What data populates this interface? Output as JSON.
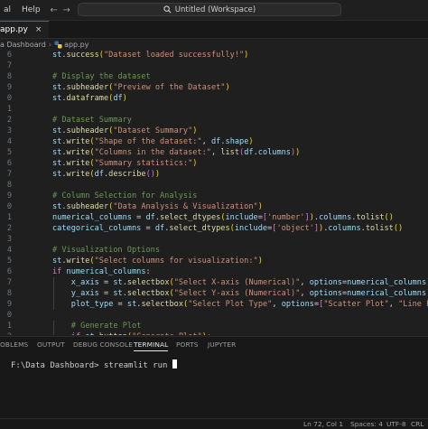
{
  "titlebar": {
    "menu": [
      "al",
      "Help"
    ],
    "back_arrow": "←",
    "forward_arrow": "→",
    "workspace_title": "Untitled (Workspace)"
  },
  "tabs": [
    {
      "label": "app.py",
      "close": "×"
    }
  ],
  "breadcrumb": {
    "folder": "a Dashboard",
    "separator": "›",
    "file": "app.py",
    "file_icon": "python-icon"
  },
  "editor": {
    "lines": [
      {
        "n": "6",
        "indent": 1,
        "tokens": [
          [
            "obj",
            "st"
          ],
          [
            "op",
            "."
          ],
          [
            "fn",
            "success"
          ],
          [
            "br1",
            "("
          ],
          [
            "str",
            "\"Dataset loaded successfully!\""
          ],
          [
            "br1",
            ")"
          ]
        ]
      },
      {
        "n": "7",
        "indent": 0,
        "tokens": []
      },
      {
        "n": "8",
        "indent": 1,
        "tokens": [
          [
            "cm",
            "# Display the dataset"
          ]
        ]
      },
      {
        "n": "9",
        "indent": 1,
        "tokens": [
          [
            "obj",
            "st"
          ],
          [
            "op",
            "."
          ],
          [
            "fn",
            "subheader"
          ],
          [
            "br1",
            "("
          ],
          [
            "str",
            "\"Preview of the Dataset\""
          ],
          [
            "br1",
            ")"
          ]
        ]
      },
      {
        "n": "0",
        "indent": 1,
        "tokens": [
          [
            "obj",
            "st"
          ],
          [
            "op",
            "."
          ],
          [
            "fn",
            "dataframe"
          ],
          [
            "br1",
            "("
          ],
          [
            "obj",
            "df"
          ],
          [
            "br1",
            ")"
          ]
        ]
      },
      {
        "n": "1",
        "indent": 0,
        "tokens": []
      },
      {
        "n": "2",
        "indent": 1,
        "tokens": [
          [
            "cm",
            "# Dataset Summary"
          ]
        ]
      },
      {
        "n": "3",
        "indent": 1,
        "tokens": [
          [
            "obj",
            "st"
          ],
          [
            "op",
            "."
          ],
          [
            "fn",
            "subheader"
          ],
          [
            "br1",
            "("
          ],
          [
            "str",
            "\"Dataset Summary\""
          ],
          [
            "br1",
            ")"
          ]
        ]
      },
      {
        "n": "4",
        "indent": 1,
        "tokens": [
          [
            "obj",
            "st"
          ],
          [
            "op",
            "."
          ],
          [
            "fn",
            "write"
          ],
          [
            "br1",
            "("
          ],
          [
            "str",
            "\"Shape of the dataset:\""
          ],
          [
            "op",
            ", "
          ],
          [
            "obj",
            "df"
          ],
          [
            "op",
            "."
          ],
          [
            "obj",
            "shape"
          ],
          [
            "br1",
            ")"
          ]
        ]
      },
      {
        "n": "5",
        "indent": 1,
        "tokens": [
          [
            "obj",
            "st"
          ],
          [
            "op",
            "."
          ],
          [
            "fn",
            "write"
          ],
          [
            "br1",
            "("
          ],
          [
            "str",
            "\"Columns in the dataset:\""
          ],
          [
            "op",
            ", "
          ],
          [
            "fn",
            "list"
          ],
          [
            "br2",
            "("
          ],
          [
            "obj",
            "df"
          ],
          [
            "op",
            "."
          ],
          [
            "obj",
            "columns"
          ],
          [
            "br2",
            ")"
          ],
          [
            "br1",
            ")"
          ]
        ]
      },
      {
        "n": "6",
        "indent": 1,
        "tokens": [
          [
            "obj",
            "st"
          ],
          [
            "op",
            "."
          ],
          [
            "fn",
            "write"
          ],
          [
            "br1",
            "("
          ],
          [
            "str",
            "\"Summary statistics:\""
          ],
          [
            "br1",
            ")"
          ]
        ]
      },
      {
        "n": "7",
        "indent": 1,
        "tokens": [
          [
            "obj",
            "st"
          ],
          [
            "op",
            "."
          ],
          [
            "fn",
            "write"
          ],
          [
            "br1",
            "("
          ],
          [
            "obj",
            "df"
          ],
          [
            "op",
            "."
          ],
          [
            "fn",
            "describe"
          ],
          [
            "br2",
            "()"
          ],
          [
            "br1",
            ")"
          ]
        ]
      },
      {
        "n": "8",
        "indent": 0,
        "tokens": []
      },
      {
        "n": "9",
        "indent": 1,
        "tokens": [
          [
            "cm",
            "# Column Selection for Analysis"
          ]
        ]
      },
      {
        "n": "0",
        "indent": 1,
        "tokens": [
          [
            "obj",
            "st"
          ],
          [
            "op",
            "."
          ],
          [
            "fn",
            "subheader"
          ],
          [
            "br1",
            "("
          ],
          [
            "str",
            "\"Data Analysis & Visualization\""
          ],
          [
            "br1",
            ")"
          ]
        ]
      },
      {
        "n": "1",
        "indent": 1,
        "tokens": [
          [
            "obj",
            "numerical_columns"
          ],
          [
            "op",
            " = "
          ],
          [
            "obj",
            "df"
          ],
          [
            "op",
            "."
          ],
          [
            "fn",
            "select_dtypes"
          ],
          [
            "br1",
            "("
          ],
          [
            "obj",
            "include"
          ],
          [
            "op",
            "="
          ],
          [
            "br2",
            "["
          ],
          [
            "str",
            "'number'"
          ],
          [
            "br2",
            "]"
          ],
          [
            "br1",
            ")"
          ],
          [
            "op",
            "."
          ],
          [
            "obj",
            "columns"
          ],
          [
            "op",
            "."
          ],
          [
            "fn",
            "tolist"
          ],
          [
            "br1",
            "()"
          ]
        ]
      },
      {
        "n": "2",
        "indent": 1,
        "tokens": [
          [
            "obj",
            "categorical_columns"
          ],
          [
            "op",
            " = "
          ],
          [
            "obj",
            "df"
          ],
          [
            "op",
            "."
          ],
          [
            "fn",
            "select_dtypes"
          ],
          [
            "br1",
            "("
          ],
          [
            "obj",
            "include"
          ],
          [
            "op",
            "="
          ],
          [
            "br2",
            "["
          ],
          [
            "str",
            "'object'"
          ],
          [
            "br2",
            "]"
          ],
          [
            "br1",
            ")"
          ],
          [
            "op",
            "."
          ],
          [
            "obj",
            "columns"
          ],
          [
            "op",
            "."
          ],
          [
            "fn",
            "tolist"
          ],
          [
            "br1",
            "()"
          ]
        ]
      },
      {
        "n": "3",
        "indent": 0,
        "tokens": []
      },
      {
        "n": "4",
        "indent": 1,
        "tokens": [
          [
            "cm",
            "# Visualization Options"
          ]
        ]
      },
      {
        "n": "5",
        "indent": 1,
        "tokens": [
          [
            "obj",
            "st"
          ],
          [
            "op",
            "."
          ],
          [
            "fn",
            "write"
          ],
          [
            "br1",
            "("
          ],
          [
            "str",
            "\"Select columns for visualization:\""
          ],
          [
            "br1",
            ")"
          ]
        ]
      },
      {
        "n": "6",
        "indent": 1,
        "tokens": [
          [
            "kw",
            "if "
          ],
          [
            "obj",
            "numerical_columns"
          ],
          [
            "op",
            ":"
          ]
        ]
      },
      {
        "n": "7",
        "indent": 2,
        "tokens": [
          [
            "obj",
            "x_axis"
          ],
          [
            "op",
            " = "
          ],
          [
            "obj",
            "st"
          ],
          [
            "op",
            "."
          ],
          [
            "fn",
            "selectbox"
          ],
          [
            "br1",
            "("
          ],
          [
            "str",
            "\"Select X-axis (Numerical)\""
          ],
          [
            "op",
            ", "
          ],
          [
            "obj",
            "options"
          ],
          [
            "op",
            "="
          ],
          [
            "obj",
            "numerical_columns"
          ],
          [
            "br1",
            ")"
          ]
        ]
      },
      {
        "n": "8",
        "indent": 2,
        "tokens": [
          [
            "obj",
            "y_axis"
          ],
          [
            "op",
            " = "
          ],
          [
            "obj",
            "st"
          ],
          [
            "op",
            "."
          ],
          [
            "fn",
            "selectbox"
          ],
          [
            "br1",
            "("
          ],
          [
            "str",
            "\"Select Y-axis (Numerical)\""
          ],
          [
            "op",
            ", "
          ],
          [
            "obj",
            "options"
          ],
          [
            "op",
            "="
          ],
          [
            "obj",
            "numerical_columns"
          ],
          [
            "br1",
            ")"
          ]
        ]
      },
      {
        "n": "9",
        "indent": 2,
        "tokens": [
          [
            "obj",
            "plot_type"
          ],
          [
            "op",
            " = "
          ],
          [
            "obj",
            "st"
          ],
          [
            "op",
            "."
          ],
          [
            "fn",
            "selectbox"
          ],
          [
            "br1",
            "("
          ],
          [
            "str",
            "\"Select Plot Type\""
          ],
          [
            "op",
            ", "
          ],
          [
            "obj",
            "options"
          ],
          [
            "op",
            "="
          ],
          [
            "br2",
            "["
          ],
          [
            "str",
            "\"Scatter Plot\""
          ],
          [
            "op",
            ", "
          ],
          [
            "str",
            "\"Line Plot\""
          ],
          [
            "op",
            ", "
          ],
          [
            "str",
            "\"B"
          ]
        ]
      },
      {
        "n": "0",
        "indent": 0,
        "tokens": []
      },
      {
        "n": "1",
        "indent": 2,
        "tokens": [
          [
            "cm",
            "# Generate Plot"
          ]
        ]
      },
      {
        "n": "2",
        "indent": 2,
        "tokens": [
          [
            "kw",
            "if "
          ],
          [
            "obj",
            "st"
          ],
          [
            "op",
            "."
          ],
          [
            "fn",
            "button"
          ],
          [
            "br1",
            "("
          ],
          [
            "str",
            "\"Generate Plot\""
          ],
          [
            "br1",
            ")"
          ],
          [
            "op",
            ":"
          ]
        ]
      }
    ]
  },
  "panel": {
    "tabs": [
      "OBLEMS",
      "OUTPUT",
      "DEBUG CONSOLE",
      "TERMINAL",
      "PORTS",
      "JUPYTER"
    ],
    "active_tab": "TERMINAL"
  },
  "terminal": {
    "prompt": "F:\\Data Dashboard>",
    "command": " streamlit run "
  },
  "statusbar": {
    "position": "Ln 72, Col 1",
    "spaces": "Spaces: 4",
    "encoding": "UTF-8",
    "eol": "CRL"
  },
  "colors": {
    "accent": "#0078d4",
    "background": "#1f1f1f",
    "panel": "#181818"
  }
}
